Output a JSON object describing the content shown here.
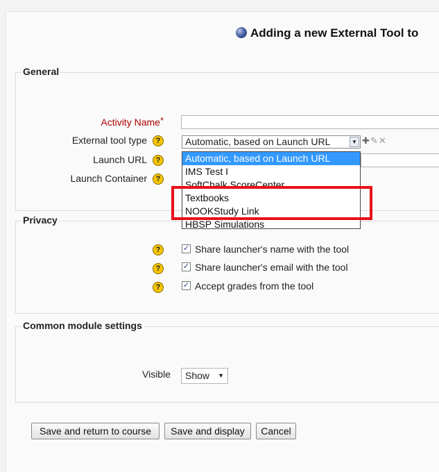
{
  "page": {
    "title": "Adding a new External Tool to"
  },
  "general": {
    "legend": "General",
    "activity_name_label": "Activity Name",
    "required_mark": "*",
    "activity_name_value": "",
    "tool_type_label": "External tool type",
    "tool_type_selected": "Automatic, based on Launch URL",
    "tool_type_options": [
      "Automatic, based on Launch URL",
      "IMS Test I",
      "SoftChalk ScoreCenter",
      "Textbooks",
      "NOOKStudy Link",
      "HBSP Simulations"
    ],
    "launch_url_label": "Launch URL",
    "launch_container_label": "Launch Container",
    "help_glyph": "?"
  },
  "privacy": {
    "legend": "Privacy",
    "items": [
      {
        "label": "Share launcher's name with the tool",
        "checked": true
      },
      {
        "label": "Share launcher's email with the tool",
        "checked": true
      },
      {
        "label": "Accept grades from the tool",
        "checked": true
      }
    ],
    "check_glyph": "✓"
  },
  "common": {
    "legend": "Common module settings",
    "visible_label": "Visible",
    "visible_value": "Show"
  },
  "buttons": {
    "save_return": "Save and return to course",
    "save_display": "Save and display",
    "cancel": "Cancel"
  },
  "icons": {
    "add_icon": "✚",
    "edit_icon": "✎",
    "delete_icon": "✕",
    "dropdown_arrow": "▼"
  },
  "colors": {
    "selection": "#3399ff",
    "highlight_box": "#e8101a",
    "required_red": "#aa0000",
    "help_yellow": "#f5c400"
  }
}
